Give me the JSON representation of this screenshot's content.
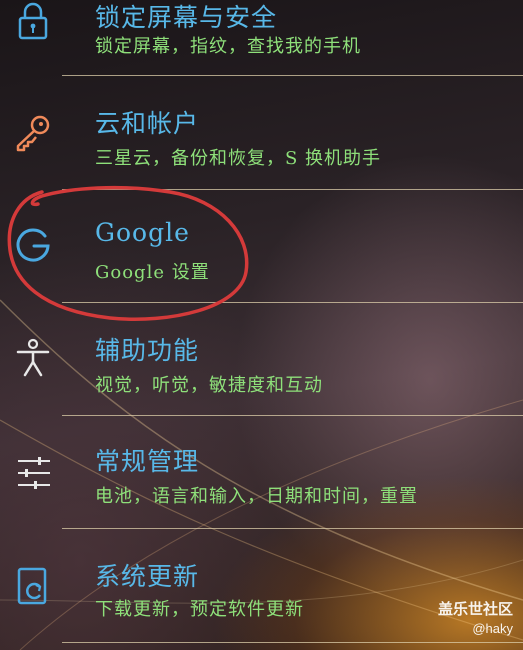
{
  "colors": {
    "title": "#58b8e8",
    "subtitle": "#8ee07a",
    "divider": "#dccdaa",
    "annotation": "#d43a3a",
    "icon_blue": "#4aa8e0",
    "icon_orange": "#f08a5a",
    "icon_white": "#e8e8e8",
    "icon_green": "#6fcf6a"
  },
  "items": [
    {
      "title": "锁定屏幕与安全",
      "subtitle": "锁定屏幕，指纹，查找我的手机",
      "icon": "lock-icon"
    },
    {
      "title": "云和帐户",
      "subtitle": "三星云，备份和恢复，S 换机助手",
      "icon": "key-icon"
    },
    {
      "title": "Google",
      "subtitle": "Google 设置",
      "icon": "google-icon"
    },
    {
      "title": "辅助功能",
      "subtitle": "视觉，听觉，敏捷度和互动",
      "icon": "accessibility-icon"
    },
    {
      "title": "常规管理",
      "subtitle": "电池，语言和输入，日期和时间，重置",
      "icon": "sliders-icon"
    },
    {
      "title": "系统更新",
      "subtitle": "下载更新，预定软件更新",
      "icon": "system-update-icon"
    }
  ],
  "watermark": {
    "site": "盖乐世社区",
    "user": "@haky"
  }
}
